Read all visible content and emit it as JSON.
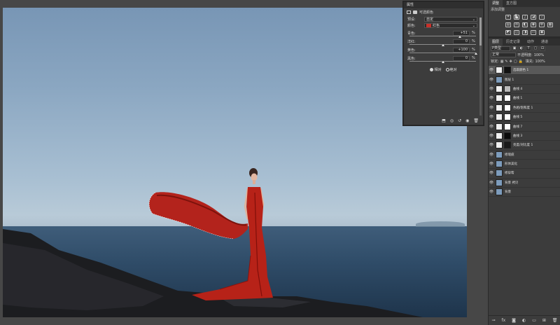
{
  "properties": {
    "panel_title": "属性",
    "header": "可选颜色",
    "preset_label": "预设:",
    "preset_value": "自定",
    "colors_label": "颜色:",
    "colors_value": "红色",
    "colors_swatch": "#c8312a",
    "sliders": [
      {
        "label": "青色:",
        "value": "+51",
        "level": 0.755
      },
      {
        "label": "洋红:",
        "value": "0",
        "level": 0.5
      },
      {
        "label": "黄色:",
        "value": "+100",
        "level": 1.0
      },
      {
        "label": "黑色:",
        "value": "0",
        "level": 0.5
      }
    ],
    "pct": "%",
    "radio_relative": "相对",
    "radio_absolute": "绝对"
  },
  "adjustments": {
    "tabs": [
      "调整",
      "直方图"
    ],
    "title": "添加调整"
  },
  "layers_panel": {
    "tabs": [
      "图层",
      "历史记录",
      "动作",
      "通道"
    ],
    "filter_label": "P类型",
    "blend_mode": "正常",
    "opacity_label": "不透明度:",
    "opacity_value": "100%",
    "lock_label": "锁定:",
    "fill_label": "填充:",
    "fill_value": "100%",
    "layers": [
      {
        "name": "选取颜色 1",
        "thumb": "#f0f0f0",
        "mask": "#111111",
        "selected": true
      },
      {
        "name": "图层 1",
        "thumb": "#7d9cbc",
        "mask": "",
        "selected": false
      },
      {
        "name": "曲线 4",
        "thumb": "#f0f0f0",
        "mask": "#bbbbbb",
        "selected": false
      },
      {
        "name": "曲线 1",
        "thumb": "#f0f0f0",
        "mask": "#ffffff",
        "selected": false
      },
      {
        "name": "色相/饱和度 1",
        "thumb": "#f0f0f0",
        "mask": "#ffffff",
        "selected": false
      },
      {
        "name": "曲线 5",
        "thumb": "#f0f0f0",
        "mask": "#ffffff",
        "selected": false
      },
      {
        "name": "曲线 7",
        "thumb": "#f0f0f0",
        "mask": "#ffffff",
        "selected": false
      },
      {
        "name": "曲线 3",
        "thumb": "#f0f0f0",
        "mask": "#0a0a0a",
        "selected": false
      },
      {
        "name": "亮度/对比度 1",
        "thumb": "#f0f0f0",
        "mask": "#1a1a1a",
        "selected": false
      },
      {
        "name": "修瑕疵",
        "thumb": "#7d9cbc",
        "mask": "",
        "selected": false
      },
      {
        "name": "形体美化",
        "thumb": "#7d9cbc",
        "mask": "",
        "selected": false
      },
      {
        "name": "修穿帮",
        "thumb": "#7d9cbc",
        "mask": "",
        "selected": false
      },
      {
        "name": "背景 拷贝",
        "thumb": "#7d9cbc",
        "mask": "",
        "selected": false
      },
      {
        "name": "背景",
        "thumb": "#7d9cbc",
        "mask": "",
        "selected": false
      }
    ]
  }
}
